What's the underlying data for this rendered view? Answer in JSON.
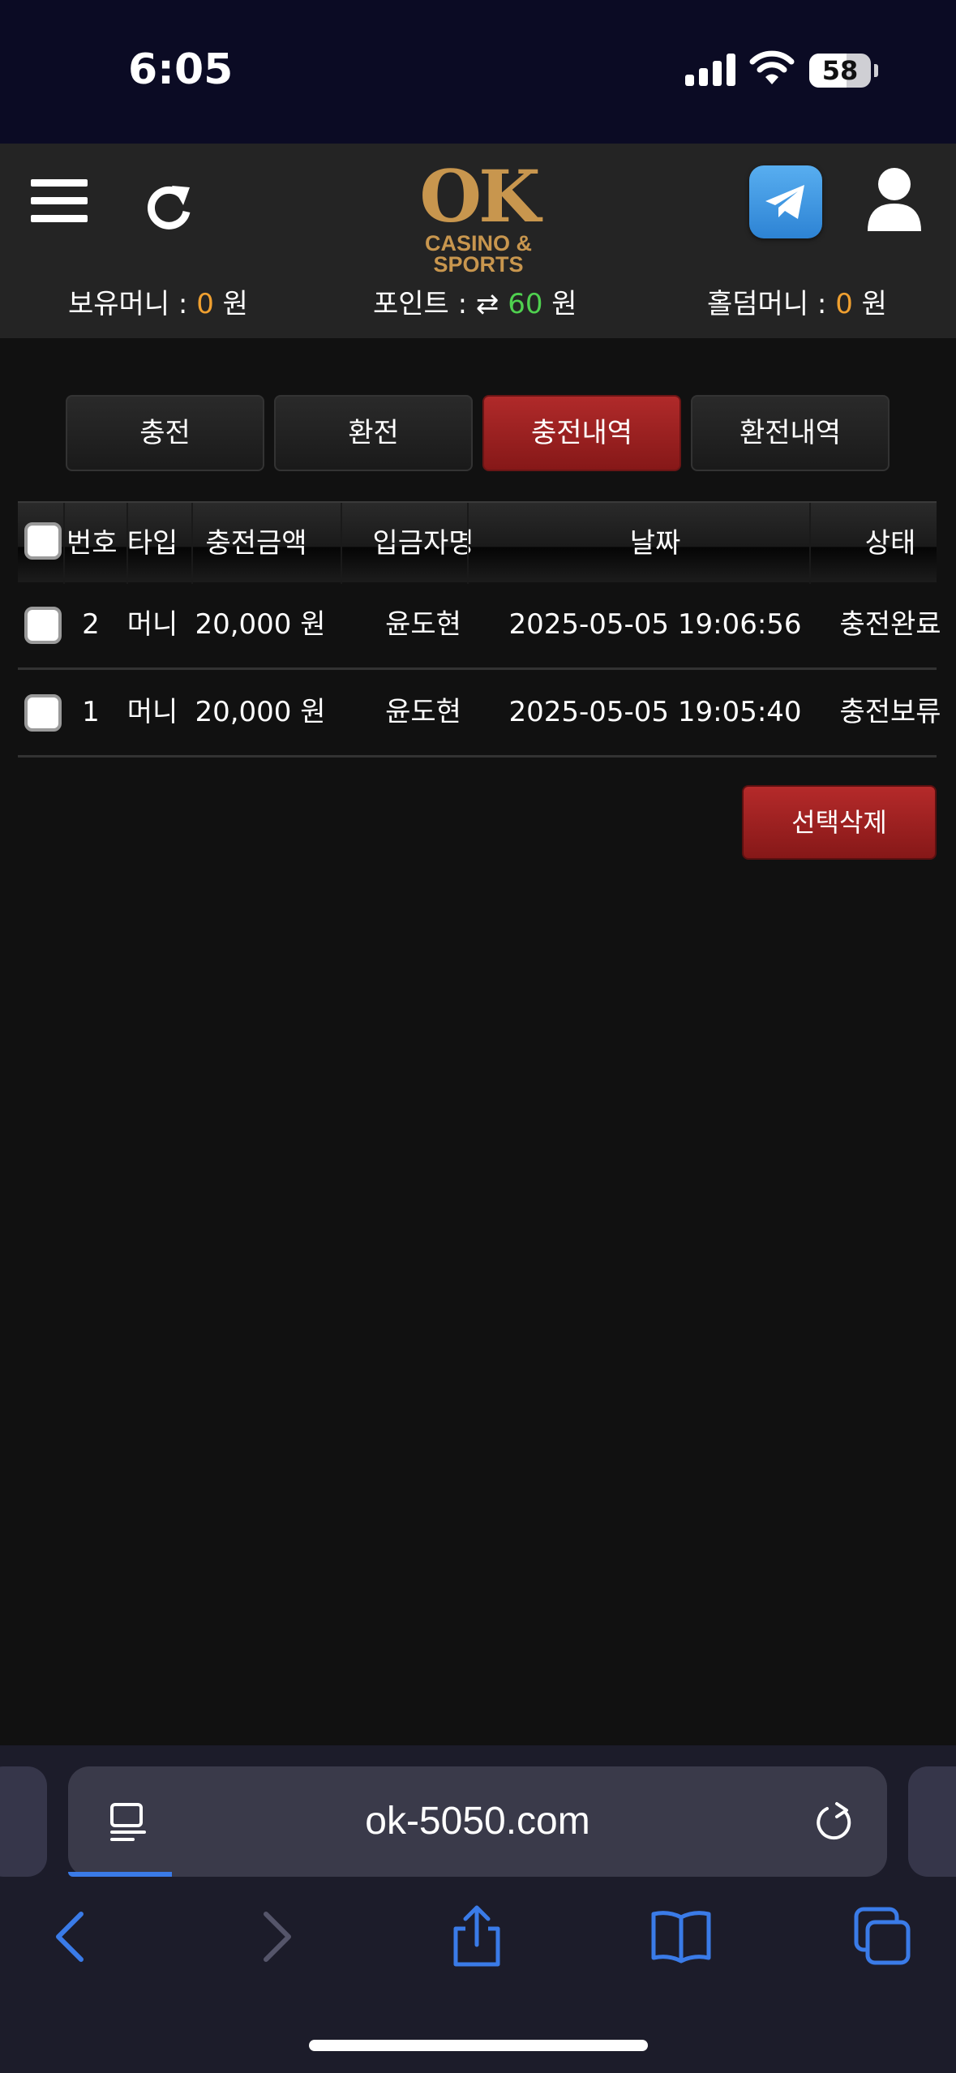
{
  "status_bar": {
    "time": "6:05",
    "battery": "58"
  },
  "header": {
    "logo_main": "OK",
    "logo_sub": "CASINO & SPORTS",
    "balances": {
      "money_label": "보유머니 : ",
      "money_value": "0",
      "money_unit": " 원",
      "point_label": "포인트 : ",
      "point_icon": "⇄",
      "point_value": "60",
      "point_unit": " 원",
      "holdem_label": "홀덤머니 : ",
      "holdem_value": "0",
      "holdem_unit": " 원"
    }
  },
  "tabs": [
    {
      "label": "충전",
      "active": false
    },
    {
      "label": "환전",
      "active": false
    },
    {
      "label": "충전내역",
      "active": true
    },
    {
      "label": "환전내역",
      "active": false
    }
  ],
  "table": {
    "headers": [
      "번호",
      "타입",
      "충전금액",
      "입금자명",
      "날짜",
      "상태"
    ],
    "rows": [
      {
        "no": "2",
        "type": "머니",
        "amount": "20,000 원",
        "depositor": "윤도현",
        "date": "2025-05-05 19:06:56",
        "status": "충전완료"
      },
      {
        "no": "1",
        "type": "머니",
        "amount": "20,000 원",
        "depositor": "윤도현",
        "date": "2025-05-05 19:05:40",
        "status": "충전보류"
      }
    ]
  },
  "delete_button": "선택삭제",
  "browser": {
    "url": "ok-5050.com"
  },
  "colors": {
    "accent_red": "#b02a2a",
    "gold": "#c8964e",
    "orange": "#f0a030",
    "green": "#4fd04f"
  }
}
